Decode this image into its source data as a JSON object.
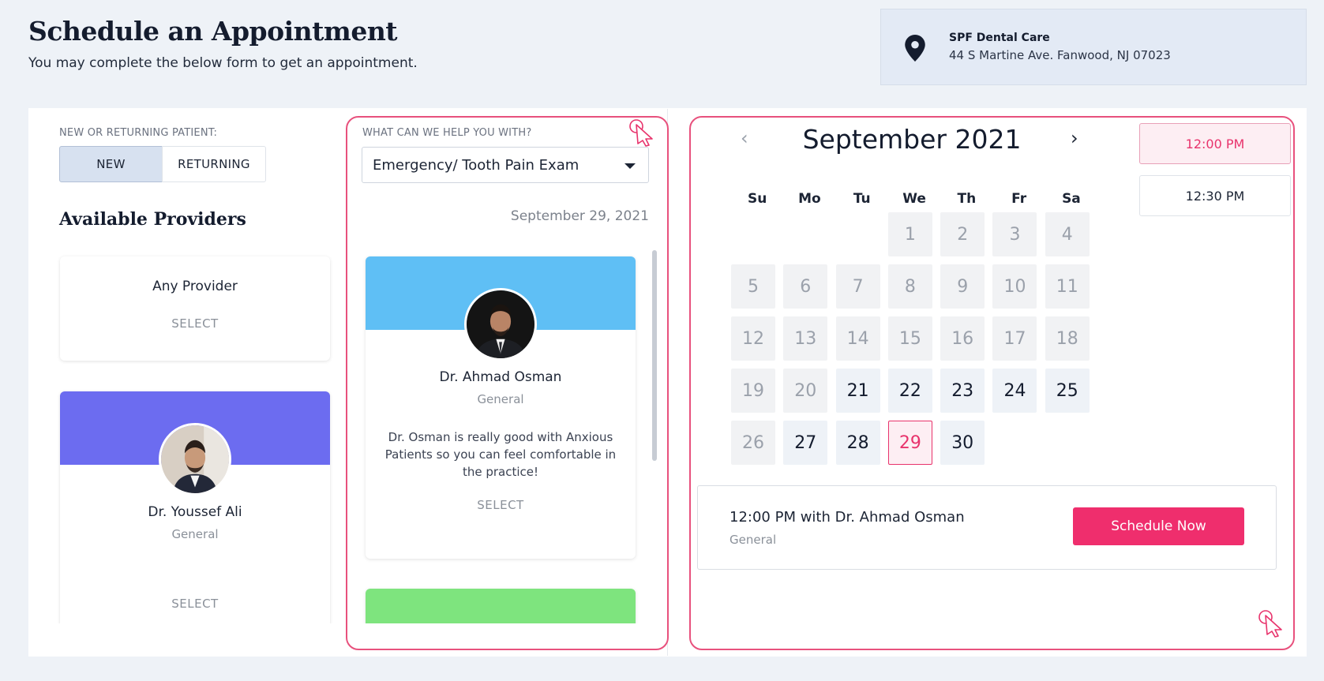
{
  "header": {
    "title": "Schedule an Appointment",
    "subtitle": "You may complete the below form to get an appointment."
  },
  "location": {
    "icon": "map-pin-icon",
    "name": "SPF Dental Care",
    "address": "44 S Martine Ave. Fanwood, NJ 07023"
  },
  "patient_type": {
    "label": "NEW OR RETURNING PATIENT:",
    "options": [
      "NEW",
      "RETURNING"
    ],
    "selected": "NEW"
  },
  "providers": {
    "heading": "Available Providers",
    "any_provider": {
      "name": "Any Provider",
      "select_label": "SELECT"
    },
    "list": [
      {
        "name": "Dr. Youssef Ali",
        "role": "General",
        "select_label": "SELECT",
        "banner_color": "#6c6cf0"
      }
    ]
  },
  "service": {
    "label": "WHAT CAN WE HELP YOU WITH?",
    "selected": "Emergency/ Tooth Pain Exam"
  },
  "date_providers": {
    "date_heading": "September 29, 2021",
    "list": [
      {
        "name": "Dr. Ahmad Osman",
        "role": "General",
        "description": "Dr. Osman is really good with Anxious Patients so you can feel comfortable in the practice!",
        "select_label": "SELECT",
        "banner_color": "#5fbff5"
      },
      {
        "banner_color": "#7ee47e"
      }
    ]
  },
  "calendar": {
    "month_label": "September 2021",
    "prev_icon": "chevron-left-icon",
    "next_icon": "chevron-right-icon",
    "weekdays": [
      "Su",
      "Mo",
      "Tu",
      "We",
      "Th",
      "Fr",
      "Sa"
    ],
    "leading_blanks": 3,
    "days_in_month": 30,
    "first_available": 21,
    "unavailable_after_first": [
      26
    ],
    "selected_day": 29
  },
  "time_slots": [
    {
      "label": "12:00 PM",
      "selected": true
    },
    {
      "label": "12:30 PM",
      "selected": false
    }
  ],
  "summary": {
    "line": "12:00 PM with Dr. Ahmad Osman",
    "role": "General",
    "button_label": "Schedule Now"
  },
  "colors": {
    "accent": "#ef2e6d",
    "panel_border": "#e8517d",
    "background": "#eef2f7",
    "selected_segment": "#d7e1f0"
  }
}
